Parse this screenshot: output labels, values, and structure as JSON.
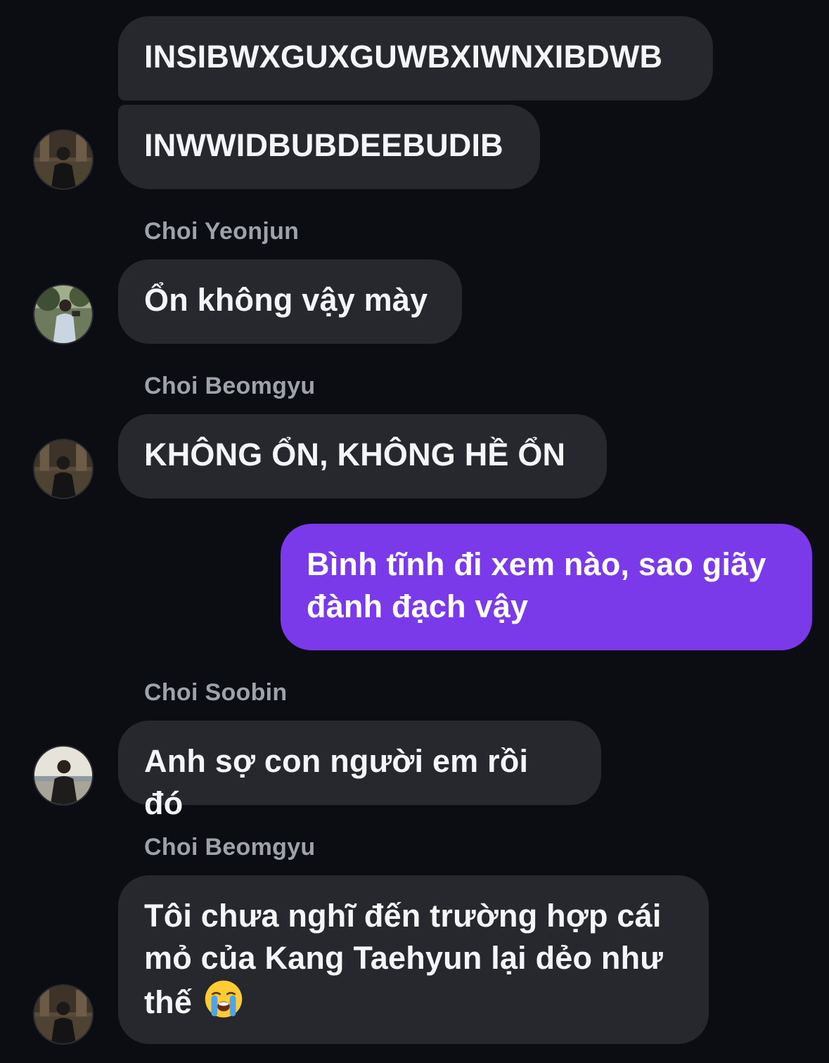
{
  "messages": [
    {
      "text": "INSIBWXGUXGUWBXIWNXIBDWB"
    },
    {
      "text": "INWWIDBUBDEEBUDIB"
    },
    {
      "sender": "Choi Yeonjun",
      "text": "Ổn không vậy mày"
    },
    {
      "sender": "Choi Beomgyu",
      "text": "KHÔNG ỔN, KHÔNG HỀ ỔN"
    },
    {
      "text_line1": "Bình tĩnh đi xem nào, sao giãy",
      "text_line2": "đành đạch vậy"
    },
    {
      "sender": "Choi Soobin",
      "text": "Anh sợ con người em rồi đó"
    },
    {
      "sender": "Choi Beomgyu",
      "text_line1": "Tôi chưa nghĩ đến trường hợp cái",
      "text_line2": "mỏ của Kang Taehyun lại dẻo như",
      "text_line3": "thế",
      "emoji": "loudly-crying-face-icon"
    }
  ],
  "colors": {
    "background": "#0b0d12",
    "incoming_bubble": "#26282d",
    "outgoing_bubble": "#7a3ae9",
    "sender_name": "#9ea3ab"
  }
}
